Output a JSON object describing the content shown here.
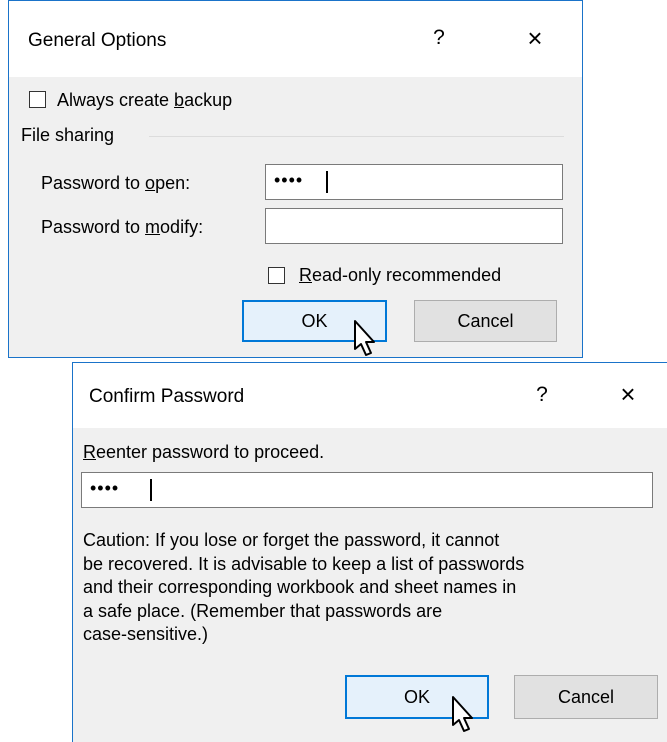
{
  "general_options": {
    "title": "General Options",
    "help": "?",
    "close": "×",
    "always_backup": {
      "pre": "Always create ",
      "key": "b",
      "post": "ackup",
      "checked": false
    },
    "file_sharing_label": "File sharing",
    "password_open": {
      "pre": "Password to ",
      "key": "o",
      "post": "pen:",
      "value": "••••"
    },
    "password_modify": {
      "pre": "Password to ",
      "key": "m",
      "post": "odify:",
      "value": ""
    },
    "read_only": {
      "pre": "",
      "key": "R",
      "post": "ead-only recommended",
      "checked": false
    },
    "ok_label": "OK",
    "cancel_label": "Cancel"
  },
  "confirm_password": {
    "title": "Confirm Password",
    "help": "?",
    "close": "×",
    "prompt": {
      "pre": "",
      "key": "R",
      "post": "eenter password to proceed."
    },
    "value": "••••",
    "caution_lines": [
      "Caution: If you lose or forget the password, it cannot",
      "be recovered. It is advisable to keep a list of passwords",
      "and their corresponding workbook and sheet names in",
      "a safe place.  (Remember that passwords are",
      "case-sensitive.)"
    ],
    "ok_label": "OK",
    "cancel_label": "Cancel"
  },
  "colors": {
    "accent": "#0078d7",
    "border": "#1a73c9",
    "dialog_bg": "#f0f0f0"
  }
}
